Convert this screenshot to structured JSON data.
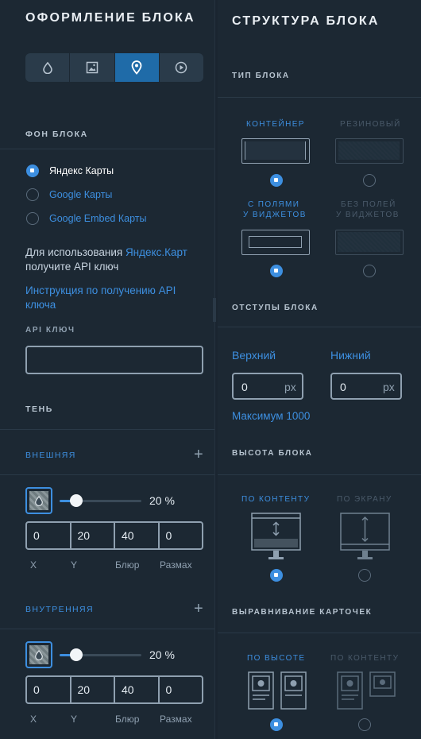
{
  "left": {
    "title": "ОФОРМЛЕНИЕ БЛОКА",
    "bg_section": "ФОН БЛОКА",
    "radios": [
      "Яндекс Карты",
      "Google Карты",
      "Google Embed Карты"
    ],
    "info_pre": "Для использования ",
    "info_link": "Яндекс.Карт",
    "info_post": "получите API ключ",
    "instruction_link": "Инструкция по получению API ключа",
    "api_label": "API КЛЮЧ",
    "api_value": "",
    "shadow_title": "ТЕНЬ",
    "outer": {
      "label": "ВНЕШНЯЯ",
      "percent": "20 %",
      "percent_value": 0.2,
      "fields": [
        "0",
        "20",
        "40",
        "0"
      ],
      "field_labels": [
        "X",
        "Y",
        "Блюр",
        "Размах"
      ]
    },
    "inner": {
      "label": "ВНУТРЕННЯЯ",
      "percent": "20 %",
      "percent_value": 0.2,
      "fields": [
        "0",
        "20",
        "40",
        "0"
      ],
      "field_labels": [
        "X",
        "Y",
        "Блюр",
        "Размах"
      ]
    },
    "tabs_icons": [
      "drop-icon",
      "image-icon",
      "map-pin-icon",
      "play-icon"
    ],
    "active_tab": "map-pin-icon"
  },
  "right": {
    "title": "СТРУКТУРА БЛОКА",
    "type_section": "ТИП БЛОКА",
    "type_opts": [
      "КОНТЕЙНЕР",
      "РЕЗИНОВЫЙ"
    ],
    "padding_opts_1": [
      "С ПОЛЯМИ",
      "БЕЗ ПОЛЕЙ"
    ],
    "padding_opts_2": [
      "У ВИДЖЕТОВ",
      "У ВИДЖЕТОВ"
    ],
    "offsets_section": "ОТСТУПЫ БЛОКА",
    "top_label": "Верхний",
    "bottom_label": "Нижний",
    "top_value": "0",
    "bottom_value": "0",
    "unit": "px",
    "max_note": "Максимум 1000",
    "height_section": "ВЫСОТА БЛОКА",
    "height_opts": [
      "ПО КОНТЕНТУ",
      "ПО ЭКРАНУ"
    ],
    "align_section": "ВЫРАВНИВАНИЕ КАРТОЧЕК",
    "align_opts": [
      "ПО ВЫСОТЕ",
      "ПО КОНТЕНТУ"
    ]
  },
  "colors": {
    "accent": "#3d8fe0",
    "bg": "#1c2833"
  }
}
